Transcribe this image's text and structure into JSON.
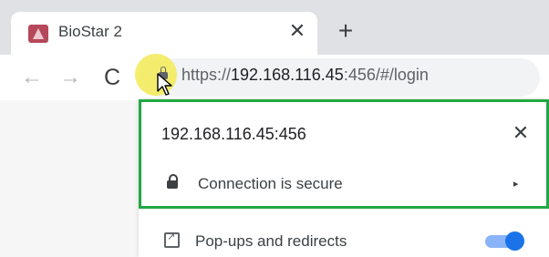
{
  "tab": {
    "title": "BioStar 2",
    "close_glyph": "✕",
    "new_tab_glyph": "+"
  },
  "toolbar": {
    "back_glyph": "←",
    "forward_glyph": "→",
    "reload_glyph": "C",
    "url_scheme": "https://",
    "url_host": "192.168.116.45",
    "url_rest": ":456/#/login"
  },
  "popup": {
    "host": "192.168.116.45:456",
    "close_glyph": "✕",
    "secure_label": "Connection is secure",
    "secure_arrow": "▸",
    "permission_label": "Pop-ups and redirects",
    "permission_enabled": true
  },
  "colors": {
    "highlight_border": "#22a844",
    "toggle_on": "#1a73e8",
    "cursor_highlight": "#f3ea55"
  }
}
